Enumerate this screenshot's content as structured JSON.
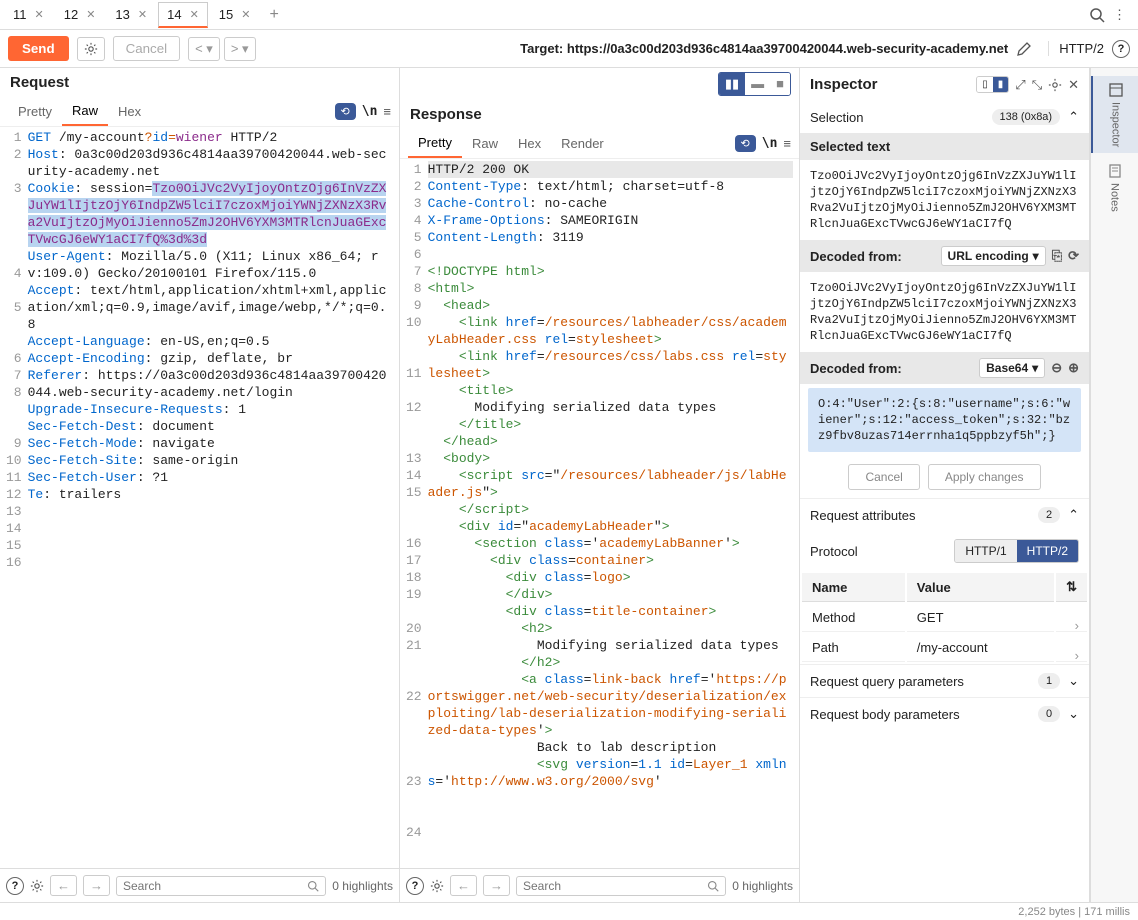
{
  "tabs": [
    "11",
    "12",
    "13",
    "14",
    "15"
  ],
  "activeTab": 3,
  "toolbar": {
    "send": "Send",
    "cancel": "Cancel",
    "target": "Target: https://0a3c00d203d936c4814aa39700420044.web-security-academy.net",
    "httpVersion": "HTTP/2"
  },
  "request": {
    "title": "Request",
    "subtabs": [
      "Pretty",
      "Raw",
      "Hex"
    ],
    "activeSubtab": 1,
    "lines": {
      "l1_method": "GET",
      "l1_path": " /my-account",
      "l1_q": "?",
      "l1_id": "id",
      "l1_eq": "=",
      "l1_val": "wiener",
      "l1_proto": " HTTP/2",
      "l2_key": "Host",
      "l2_val": ": 0a3c00d203d936c4814aa39700420044.web-security-academy.net",
      "l3_key": "Cookie",
      "l3_val": ": session=",
      "l3_sel": "Tzo0OiJVc2VyIjoyOntzOjg6InVzZXJuYW1lIjtzOjY6IndpZW5lciI7czoxMjoiYWNjZXNzX3Rva2VuIjtzOjMyOiJienno5ZmJ2OHV6YXM3MTRlcnJuaGExcTVwcGJ6eWY1aCI7fQ%3d%3d",
      "l4_key": "User-Agent",
      "l4_val": ": Mozilla/5.0 (X11; Linux x86_64; rv:109.0) Gecko/20100101 Firefox/115.0",
      "l5_key": "Accept",
      "l5_val": ": text/html,application/xhtml+xml,application/xml;q=0.9,image/avif,image/webp,*/*;q=0.8",
      "l6_key": "Accept-Language",
      "l6_val": ": en-US,en;q=0.5",
      "l7_key": "Accept-Encoding",
      "l7_val": ": gzip, deflate, br",
      "l8_key": "Referer",
      "l8_val": ": https://0a3c00d203d936c4814aa39700420044.web-security-academy.net/login",
      "l9_key": "Upgrade-Insecure-Requests",
      "l9_val": ": 1",
      "l10_key": "Sec-Fetch-Dest",
      "l10_val": ": document",
      "l11_key": "Sec-Fetch-Mode",
      "l11_val": ": navigate",
      "l12_key": "Sec-Fetch-Site",
      "l12_val": ": same-origin",
      "l13_key": "Sec-Fetch-User",
      "l13_val": ": ?1",
      "l14_key": "Te",
      "l14_val": ": trailers"
    },
    "searchPlaceholder": "Search",
    "highlights": "0 highlights"
  },
  "response": {
    "title": "Response",
    "subtabs": [
      "Pretty",
      "Raw",
      "Hex",
      "Render"
    ],
    "activeSubtab": 0,
    "lines": {
      "l1": "HTTP/2 200 OK",
      "l2_key": "Content-Type",
      "l2_val": ": text/html; charset=utf-8",
      "l3_key": "Cache-Control",
      "l3_val": ": no-cache",
      "l4_key": "X-Frame-Options",
      "l4_val": ": SAMEORIGIN",
      "l5_key": "Content-Length",
      "l5_val": ": 3119",
      "doctype": "<!DOCTYPE html>",
      "title_text": "Modifying serialized data types",
      "css1": "/resources/labheader/css/academyLabHeader.css",
      "css2": "/resources/css/labs.css",
      "js1": "/resources/labheader/js/labHeader.js",
      "id1": "academyLabHeader",
      "cls1": "academyLabBanner",
      "cls2": "container",
      "cls3": "logo",
      "cls4": "title-container",
      "cls5": "link-back",
      "href1": "https://portswigger.net/web-security/deserialization/exploiting/lab-deserialization-modifying-serialized-data-types",
      "back_text": "Back to lab description ",
      "svg_ver": "1.1",
      "svg_id": "Layer_1",
      "svg_ns": "http://www.w3.org/2000/svg"
    },
    "searchPlaceholder": "Search",
    "highlights": "0 highlights"
  },
  "inspector": {
    "title": "Inspector",
    "selection": {
      "label": "Selection",
      "count": "138 (0x8a)"
    },
    "selectedText": {
      "header": "Selected text",
      "value": "Tzo0OiJVc2VyIjoyOntzOjg6InVzZXJuYW1lIjtzOjY6IndpZW5lciI7czoxMjoiYWNjZXNzX3Rva2VuIjtzOjMyOiJienno5ZmJ2OHV6YXM3MTRlcnJuaGExcTVwcGJ6eWY1aCI7fQ"
    },
    "decoded1": {
      "header": "Decoded from:",
      "scheme": "URL encoding",
      "value": "Tzo0OiJVc2VyIjoyOntzOjg6InVzZXJuYW1lIjtzOjY6IndpZW5lciI7czoxMjoiYWNjZXNzX3Rva2VuIjtzOjMyOiJienno5ZmJ2OHV6YXM3MTRlcnJuaGExcTVwcGJ6eWY1aCI7fQ"
    },
    "decoded2": {
      "header": "Decoded from:",
      "scheme": "Base64",
      "value": "O:4:\"User\":2:{s:8:\"username\";s:6:\"wiener\";s:12:\"access_token\";s:32:\"bzz9fbv8uzas714errnha1q5ppbzyf5h\";}"
    },
    "cancelBtn": "Cancel",
    "applyBtn": "Apply changes",
    "reqAttrs": {
      "label": "Request attributes",
      "count": "2"
    },
    "protocol": {
      "label": "Protocol",
      "http1": "HTTP/1",
      "http2": "HTTP/2"
    },
    "table": {
      "nameHeader": "Name",
      "valueHeader": "Value",
      "rows": [
        {
          "name": "Method",
          "value": "GET"
        },
        {
          "name": "Path",
          "value": "/my-account"
        }
      ]
    },
    "queryParams": {
      "label": "Request query parameters",
      "count": "1"
    },
    "bodyParams": {
      "label": "Request body parameters",
      "count": "0"
    }
  },
  "rail": {
    "inspector": "Inspector",
    "notes": "Notes"
  },
  "statusBar": {
    "right": "2,252 bytes | 171 millis"
  }
}
